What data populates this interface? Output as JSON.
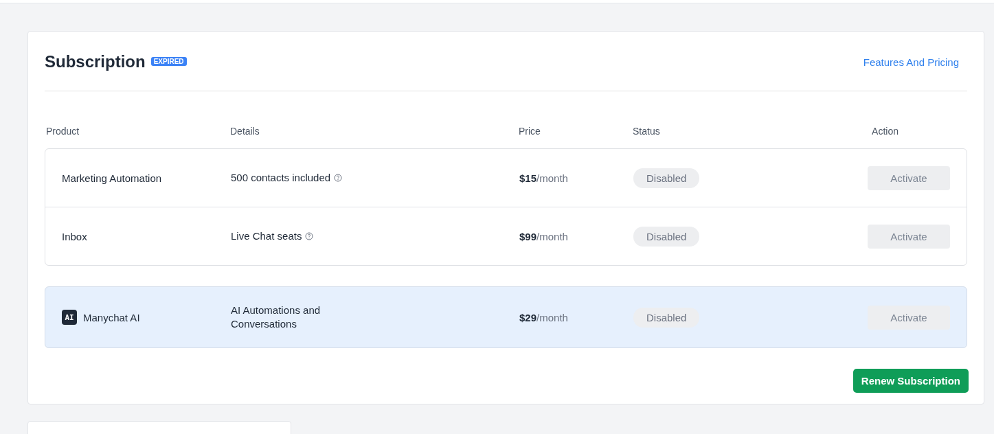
{
  "title": "Subscription",
  "status_badge": "EXPIRED",
  "link": "Features And Pricing",
  "columns": [
    "Product",
    "Details",
    "Price",
    "Status",
    "Action"
  ],
  "groups": [
    {
      "highlighted": false,
      "rows": [
        {
          "product": "Marketing Automation",
          "details": "500 contacts included",
          "info": true,
          "amount": "$15",
          "period": "/month",
          "status": "Disabled",
          "action": "Activate",
          "action_disabled": true
        },
        {
          "product": "Inbox",
          "details": "Live Chat seats",
          "info": true,
          "amount": "$99",
          "period": "/month",
          "status": "Disabled",
          "action": "Activate",
          "action_disabled": true
        }
      ]
    },
    {
      "highlighted": true,
      "rows": [
        {
          "icon_text": "AI",
          "product": "Manychat AI",
          "details": "AI Automations and Conversations",
          "info": false,
          "amount": "$29",
          "period": "/month",
          "status": "Disabled",
          "action": "Activate",
          "action_disabled": true
        }
      ]
    }
  ],
  "renew_button": "Renew Subscription"
}
